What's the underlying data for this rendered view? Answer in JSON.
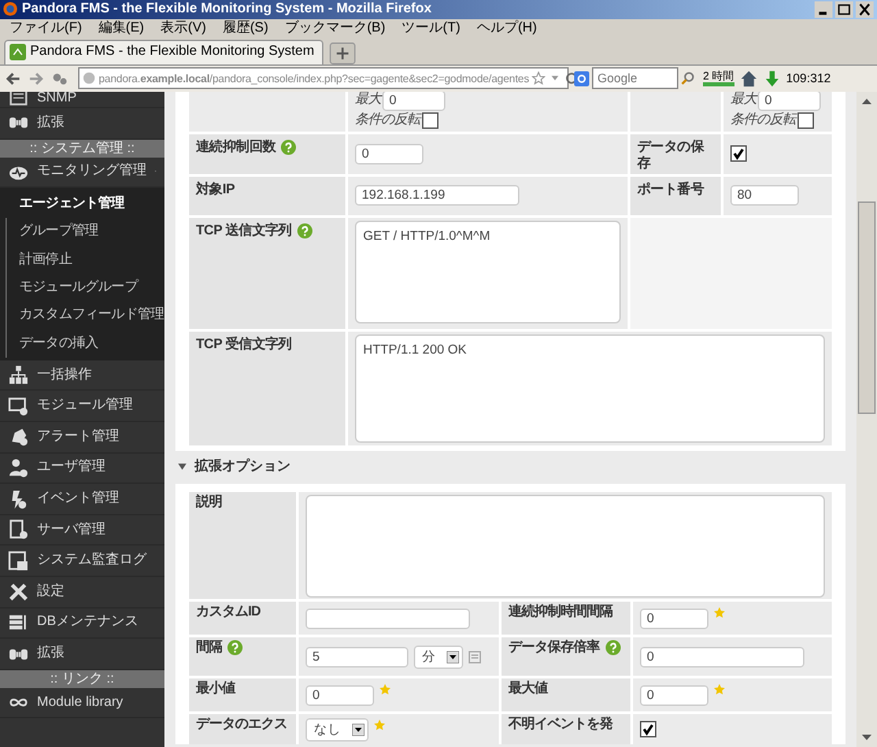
{
  "window": {
    "title": "Pandora FMS - the Flexible Monitoring System - Mozilla Firefox"
  },
  "menu": [
    "ファイル(F)",
    "編集(E)",
    "表示(V)",
    "履歴(S)",
    "ブックマーク(B)",
    "ツール(T)",
    "ヘルプ(H)"
  ],
  "tabs": [
    {
      "label": "Pandora FMS - the Flexible Monitoring System",
      "selected": true
    }
  ],
  "address_bar": {
    "url": "pandora.**example.local**/pandora_console/index.php?sec=gagente&sec2=godmode/agentes"
  },
  "search": {
    "placeholder": "Google"
  },
  "toolbar": {
    "time_badge": "2 時間",
    "counter": "109:312"
  },
  "sidebar": {
    "items": [
      {
        "kind": "item",
        "label": "SNMP",
        "selected": false
      },
      {
        "kind": "item",
        "label": "拡張",
        "selected": false
      },
      {
        "kind": "header",
        "label": ":: システム管理 ::"
      },
      {
        "kind": "item",
        "label": "モニタリング管理",
        "selected": false,
        "expanded": true,
        "children": [
          {
            "label": "エージェント管理",
            "selected": true
          },
          {
            "label": "グループ管理",
            "selected": false
          },
          {
            "label": "計画停止",
            "selected": false
          },
          {
            "label": "モジュールグループ",
            "selected": false
          },
          {
            "label": "カスタムフィールド管理",
            "selected": false
          },
          {
            "label": "データの挿入",
            "selected": false
          }
        ]
      },
      {
        "kind": "item",
        "label": "一括操作",
        "selected": false
      },
      {
        "kind": "item",
        "label": "モジュール管理",
        "selected": false
      },
      {
        "kind": "item",
        "label": "アラート管理",
        "selected": false
      },
      {
        "kind": "item",
        "label": "ユーザ管理",
        "selected": false
      },
      {
        "kind": "item",
        "label": "イベント管理",
        "selected": false
      },
      {
        "kind": "item",
        "label": "サーバ管理",
        "selected": false
      },
      {
        "kind": "item",
        "label": "システム監査ログ",
        "selected": false
      },
      {
        "kind": "item",
        "label": "設定",
        "selected": false
      },
      {
        "kind": "item",
        "label": "DBメンテナンス",
        "selected": false
      },
      {
        "kind": "item",
        "label": "拡張",
        "selected": false
      },
      {
        "kind": "header",
        "label": ":: リンク ::"
      },
      {
        "kind": "item",
        "label": "Module library",
        "selected": false
      }
    ]
  },
  "form": {
    "rows": [
      {
        "cells": [
          {
            "kind": "empty"
          },
          {
            "kind": "max_invert",
            "max_label": "最大",
            "value": "0",
            "invert_label": "条件の反転",
            "checked": false
          },
          {
            "kind": "empty"
          },
          {
            "kind": "max_invert",
            "max_label": "最大",
            "value": "0",
            "invert_label": "条件の反転",
            "checked": false
          }
        ]
      },
      {
        "cells": [
          {
            "kind": "label",
            "text": "連続抑制回数",
            "help": true
          },
          {
            "kind": "short_field",
            "value": "0",
            "required": false
          },
          {
            "kind": "label",
            "text": "データの保存",
            "help": false
          },
          {
            "kind": "checkbox",
            "checked": true
          }
        ]
      },
      {
        "cells": [
          {
            "kind": "label",
            "text": "対象IP",
            "help": false
          },
          {
            "kind": "field",
            "value": "192.168.1.199",
            "required": false
          },
          {
            "kind": "label",
            "text": "ポート番号",
            "help": false
          },
          {
            "kind": "short_field",
            "value": "80",
            "required": false
          }
        ]
      },
      {
        "cells": [
          {
            "kind": "label",
            "text": "TCP 送信文字列",
            "help": true
          },
          {
            "kind": "textarea",
            "value": "GET / HTTP/1.0^M^M"
          },
          {
            "kind": "blank"
          }
        ]
      },
      {
        "cells": [
          {
            "kind": "label",
            "text": "TCP 受信文字列",
            "help": false
          },
          {
            "kind": "textarea_wide",
            "value": "HTTP/1.1 200 OK"
          }
        ]
      }
    ]
  },
  "advanced": {
    "title": "拡張オプション",
    "expanded": true,
    "rows": [
      {
        "cells": [
          {
            "kind": "label",
            "text": "説明",
            "help": false
          },
          {
            "kind": "textarea_wide"
          }
        ]
      },
      {
        "cells": [
          {
            "kind": "label",
            "text": "カスタムID",
            "help": false
          },
          {
            "kind": "field",
            "required": false
          },
          {
            "kind": "label",
            "text": "連続抑制時間間隔",
            "help": false
          },
          {
            "kind": "short_field",
            "value": "0",
            "required": true
          }
        ]
      },
      {
        "cells": [
          {
            "kind": "label",
            "text": "間隔",
            "help": true
          },
          {
            "kind": "interval",
            "value": "5",
            "unit": "分"
          },
          {
            "kind": "label",
            "text": "データ保存倍率",
            "help": true
          },
          {
            "kind": "field",
            "value": "0",
            "required": false
          }
        ]
      },
      {
        "cells": [
          {
            "kind": "label",
            "text": "最小値",
            "help": false
          },
          {
            "kind": "short_field",
            "value": "0",
            "required": true
          },
          {
            "kind": "label",
            "text": "最大値",
            "help": false
          },
          {
            "kind": "short_field",
            "value": "0",
            "required": true
          }
        ]
      },
      {
        "cells": [
          {
            "kind": "label",
            "text": "データのエクス",
            "help": false
          },
          {
            "kind": "select",
            "value": "なし",
            "required": true
          },
          {
            "kind": "label",
            "text": "不明イベントを発",
            "help": false
          },
          {
            "kind": "checkbox",
            "checked": true
          }
        ]
      }
    ]
  }
}
